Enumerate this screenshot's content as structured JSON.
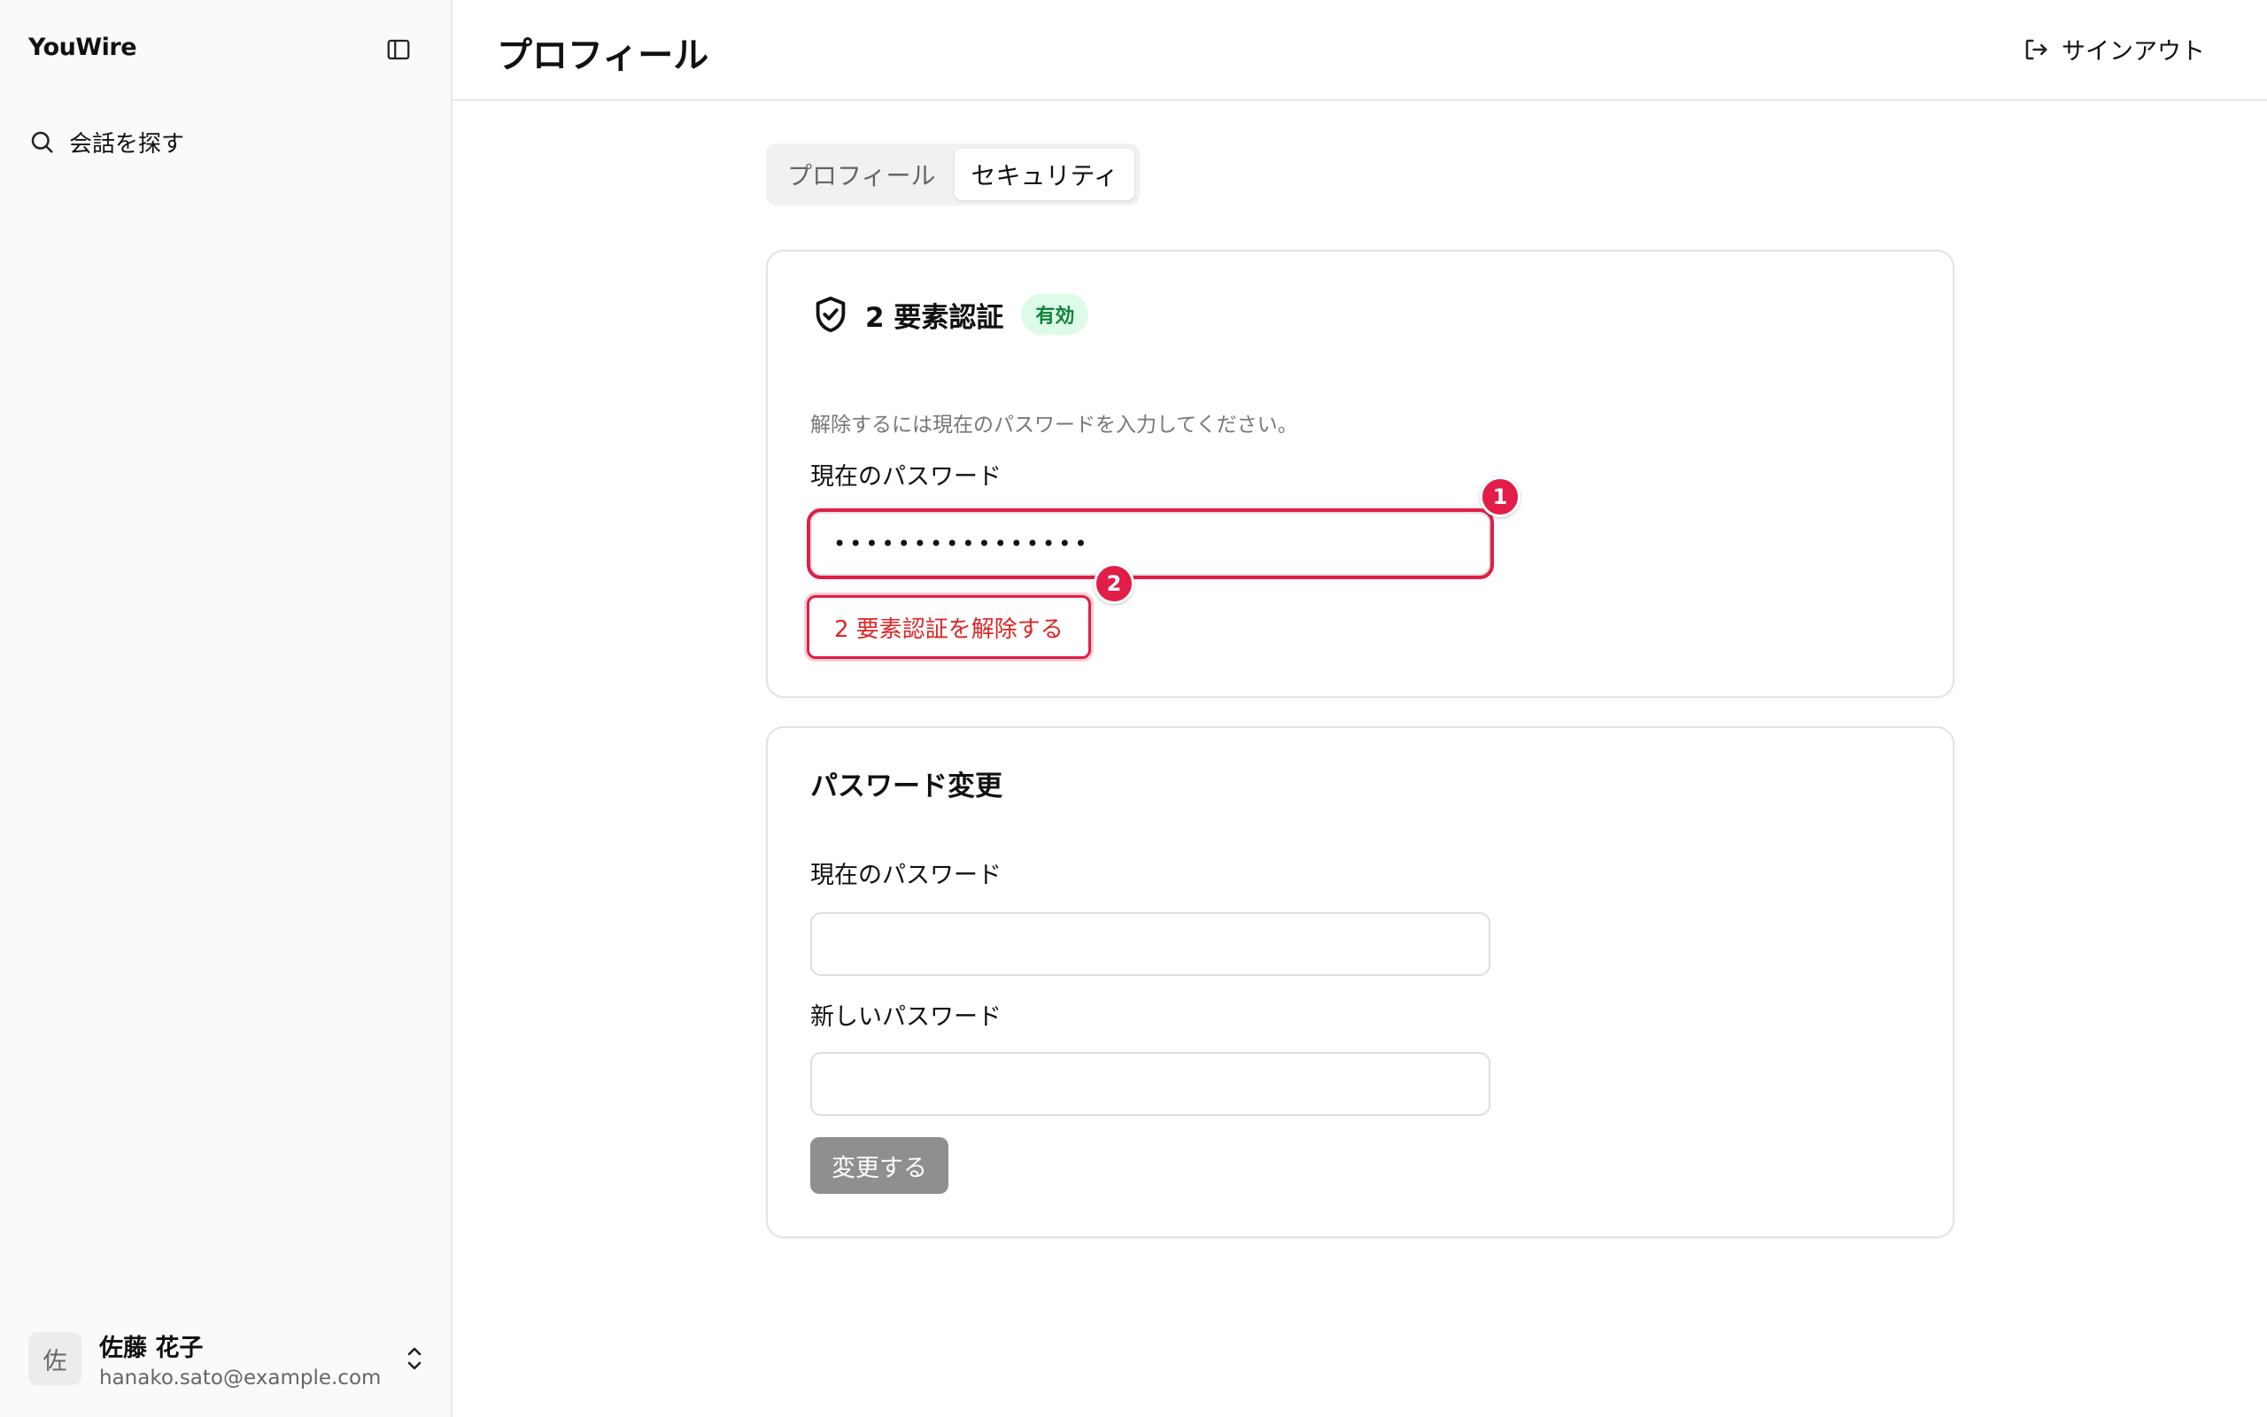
{
  "app": {
    "brand": "YouWire"
  },
  "sidebar": {
    "nav": [
      {
        "label": "会話を探す",
        "icon": "search-icon"
      }
    ],
    "user": {
      "avatar_initial": "佐",
      "name": "佐藤 花子",
      "email": "hanako.sato@example.com"
    }
  },
  "header": {
    "title": "プロフィール",
    "signout_label": "サインアウト"
  },
  "tabs": [
    {
      "label": "プロフィール",
      "active": false
    },
    {
      "label": "セキュリティ",
      "active": true
    }
  ],
  "two_factor": {
    "title": "2 要素認証",
    "status_badge": "有効",
    "hint": "解除するには現在のパスワードを入力してください。",
    "current_password_label": "現在のパスワード",
    "current_password_value": "••••••••••••••••",
    "disable_button": "2 要素認証を解除する",
    "markers": [
      "1",
      "2"
    ]
  },
  "password_change": {
    "title": "パスワード変更",
    "current_password_label": "現在のパスワード",
    "current_password_value": "",
    "new_password_label": "新しいパスワード",
    "new_password_value": "",
    "submit_button": "変更する"
  },
  "colors": {
    "accent_danger": "#e11d48",
    "badge_bg": "#dcfce7",
    "badge_text": "#15803d",
    "disabled_button": "#8f8f8f"
  }
}
